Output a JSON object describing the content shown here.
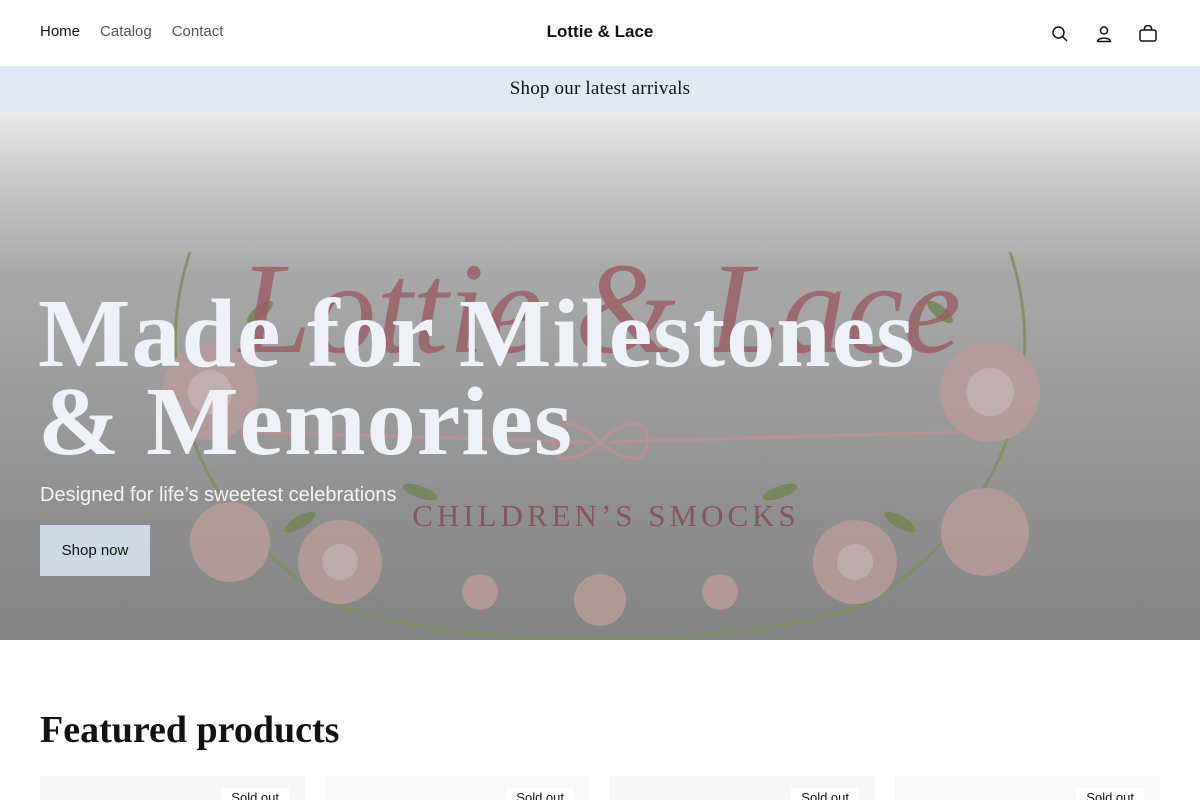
{
  "header": {
    "nav": [
      {
        "label": "Home",
        "active": true
      },
      {
        "label": "Catalog",
        "active": false
      },
      {
        "label": "Contact",
        "active": false
      }
    ],
    "brand": "Lottie & Lace",
    "icons": [
      "search-icon",
      "account-icon",
      "cart-icon"
    ]
  },
  "announcement": {
    "text": "Shop our latest arrivals"
  },
  "hero": {
    "title_line1": "Made for Milestones",
    "title_line2": "& Memories",
    "subtitle": "Designed for life’s sweetest celebrations",
    "button": "Shop now",
    "logo_script": "Lottie & Lace",
    "logo_caption": "CHILDREN’S SMOCKS"
  },
  "featured": {
    "title": "Featured products",
    "products": [
      {
        "badge": "Sold out"
      },
      {
        "badge": "Sold out"
      },
      {
        "badge": "Sold out"
      },
      {
        "badge": "Sold out"
      }
    ]
  },
  "colors": {
    "announcement_bg": "#e2e8ef",
    "button_bg": "#cfd9e6",
    "logo_rose": "#a8636e"
  }
}
